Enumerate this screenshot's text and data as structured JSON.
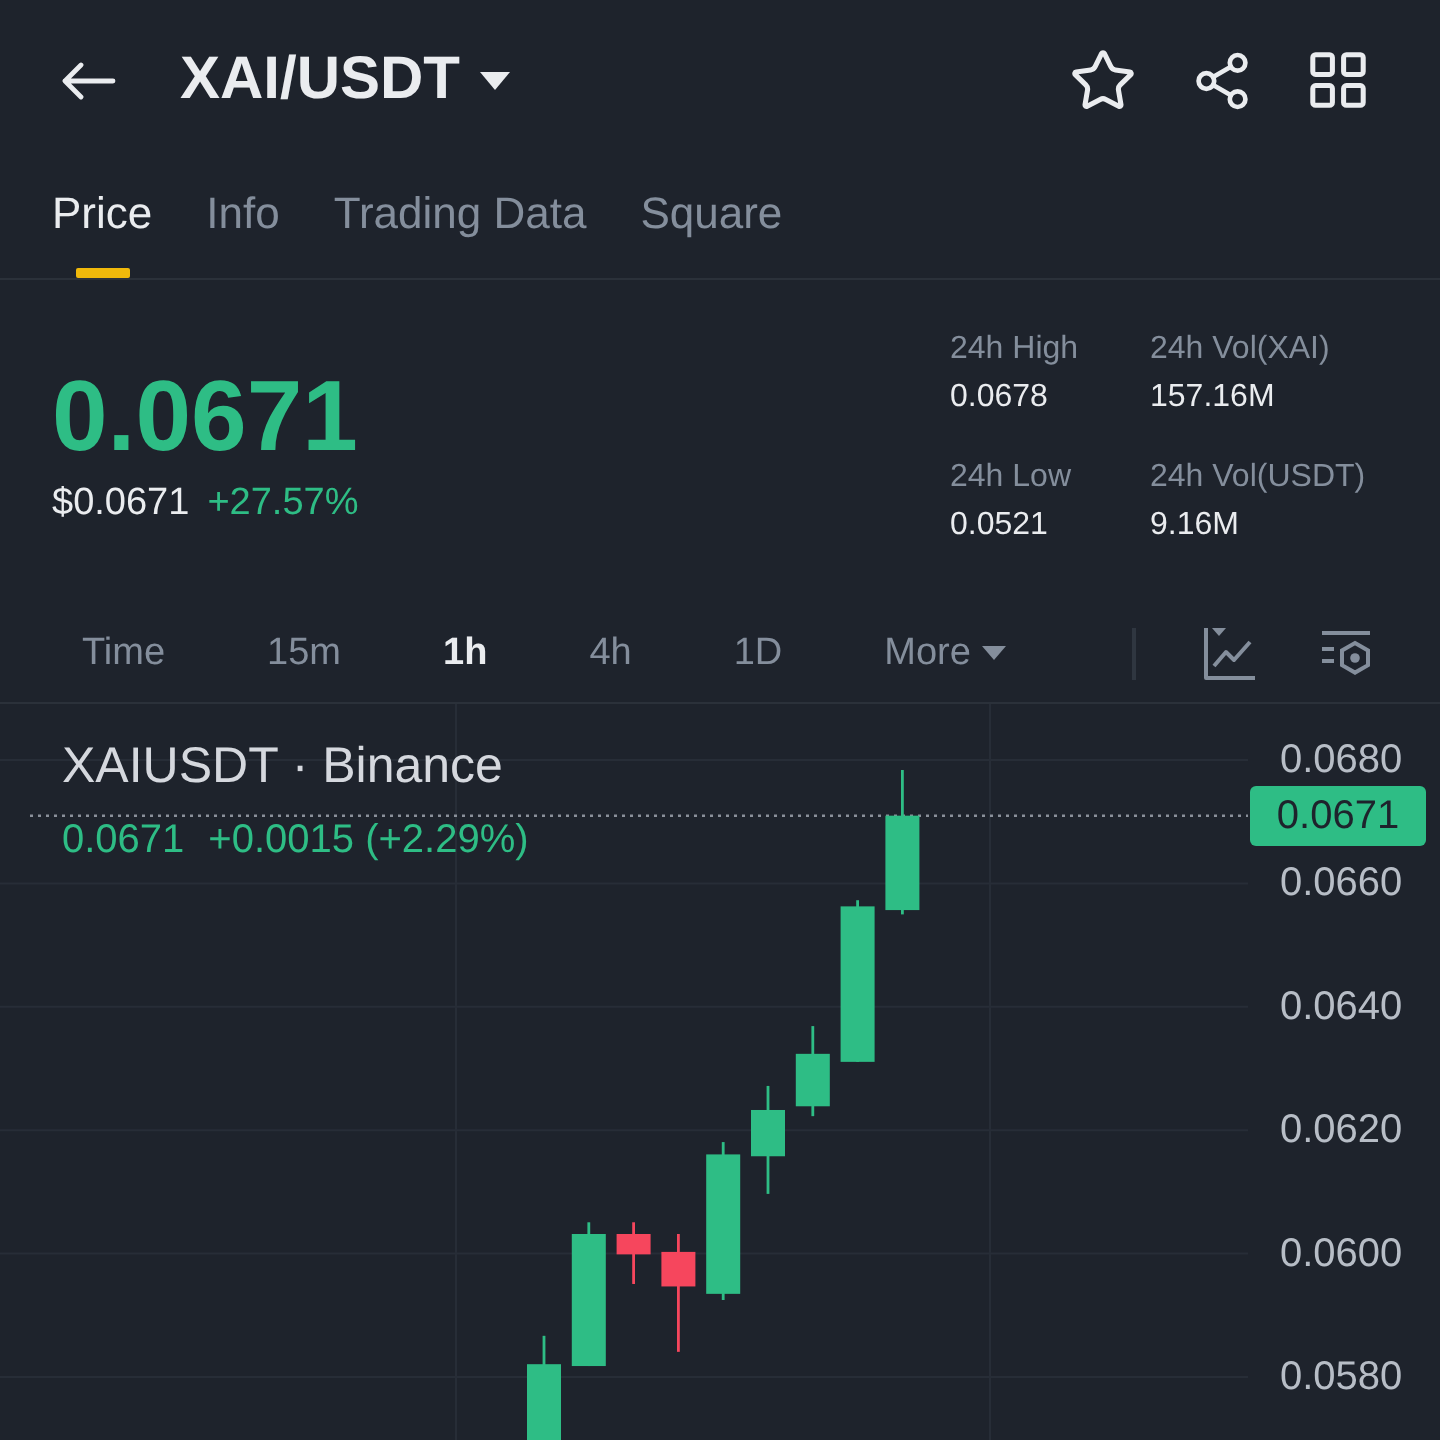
{
  "header": {
    "title": "XAI/USDT"
  },
  "tabs": [
    {
      "label": "Price",
      "selected": true
    },
    {
      "label": "Info",
      "selected": false
    },
    {
      "label": "Trading Data",
      "selected": false
    },
    {
      "label": "Square",
      "selected": false
    }
  ],
  "ticker": {
    "rising": true,
    "price": "0.0671",
    "fiat_price": "$0.0671",
    "change": "+27.57%"
  },
  "stats": [
    {
      "label": "24h High",
      "value": "0.0678"
    },
    {
      "label": "24h Vol(XAI)",
      "value": "157.16M"
    },
    {
      "label": "24h Low",
      "value": "0.0521"
    },
    {
      "label": "24h Vol(USDT)",
      "value": "9.16M"
    }
  ],
  "intervals": [
    {
      "kind": "option",
      "label": "Time",
      "selected": false
    },
    {
      "kind": "option",
      "label": "15m",
      "selected": false
    },
    {
      "kind": "option",
      "label": "1h",
      "selected": true
    },
    {
      "kind": "option",
      "label": "4h",
      "selected": false
    },
    {
      "kind": "option",
      "label": "1D",
      "selected": false
    },
    {
      "kind": "dropdown",
      "label": "More",
      "selected": false
    }
  ],
  "chart": {
    "title": "XAIUSDT · Binance",
    "legend": {
      "rising": true,
      "price": "0.0671",
      "change": "+0.0015 (+2.29%)"
    },
    "price_tag": "0.0671",
    "axis_labels": [
      "0.0680",
      "0.0660",
      "0.0640",
      "0.0620",
      "0.0600",
      "0.0580"
    ]
  }
}
